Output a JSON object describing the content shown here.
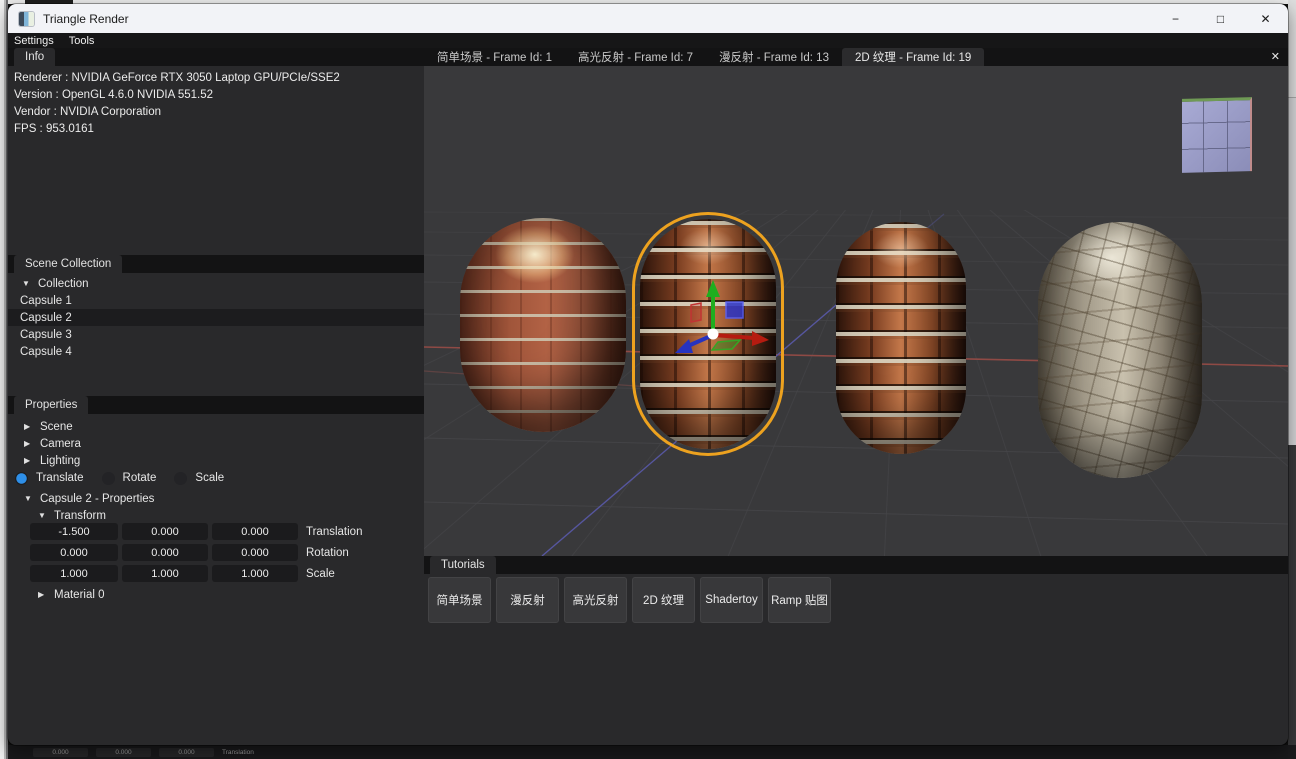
{
  "window": {
    "title": "Triangle Render",
    "minimize_icon": "−",
    "maximize_icon": "□",
    "close_icon": "✕"
  },
  "menu_bar": {
    "items": [
      {
        "label": "Settings"
      },
      {
        "label": "Tools"
      }
    ]
  },
  "icons": {
    "expanded_arrow": "▼",
    "collapsed_arrow": "▶",
    "tab_close": "✕"
  },
  "info_panel": {
    "tab_label": "Info",
    "lines": [
      "Renderer : NVIDIA GeForce RTX 3050 Laptop GPU/PCIe/SSE2",
      "Version : OpenGL 4.6.0 NVIDIA 551.52",
      "Vendor : NVIDIA Corporation",
      "FPS : 953.0161"
    ]
  },
  "scene_collection": {
    "tab_label": "Scene Collection",
    "root_label": "Collection",
    "items": [
      {
        "label": "Capsule 1",
        "selected": false
      },
      {
        "label": "Capsule 2",
        "selected": true
      },
      {
        "label": "Capsule 3",
        "selected": false
      },
      {
        "label": "Capsule 4",
        "selected": false
      }
    ]
  },
  "properties_panel": {
    "tab_label": "Properties",
    "groups": [
      {
        "label": "Scene"
      },
      {
        "label": "Camera"
      },
      {
        "label": "Lighting"
      }
    ],
    "modes": [
      {
        "label": "Translate",
        "selected": true
      },
      {
        "label": "Rotate",
        "selected": false
      },
      {
        "label": "Scale",
        "selected": false
      }
    ],
    "object_header": "Capsule 2 - Properties",
    "transform_header": "Transform",
    "transform_rows": [
      {
        "label": "Translation",
        "values": [
          "-1.500",
          "0.000",
          "0.000"
        ]
      },
      {
        "label": "Rotation",
        "values": [
          "0.000",
          "0.000",
          "0.000"
        ]
      },
      {
        "label": "Scale",
        "values": [
          "1.000",
          "1.000",
          "1.000"
        ]
      }
    ],
    "material_label": "Material 0"
  },
  "viewport": {
    "tabs": [
      {
        "label": "简单场景 - Frame Id: 1",
        "active": false
      },
      {
        "label": "高光反射 - Frame Id: 7",
        "active": false
      },
      {
        "label": "漫反射 - Frame Id: 13",
        "active": false
      },
      {
        "label": "2D 纹理 - Frame Id: 19",
        "active": true
      }
    ],
    "close_icon": "✕"
  },
  "tutorials_panel": {
    "tab_label": "Tutorials",
    "buttons": [
      {
        "label": "简单场景"
      },
      {
        "label": "漫反射"
      },
      {
        "label": "高光反射"
      },
      {
        "label": "2D 纹理"
      },
      {
        "label": "Shadertoy"
      },
      {
        "label": "Ramp 贴图"
      }
    ]
  },
  "background_window": {
    "values": [
      "0.000",
      "0.000",
      "0.000"
    ],
    "label": "Translation"
  },
  "colors": {
    "accent_blue": "#2e8fe8",
    "selection_outline": "#eda21f",
    "axis_x_red": "#b51b10",
    "axis_y_green": "#1fae1f",
    "axis_z_blue": "#2633c0",
    "titlebar_bg": "#f2f3f7",
    "panel_bg": "#29292b"
  }
}
